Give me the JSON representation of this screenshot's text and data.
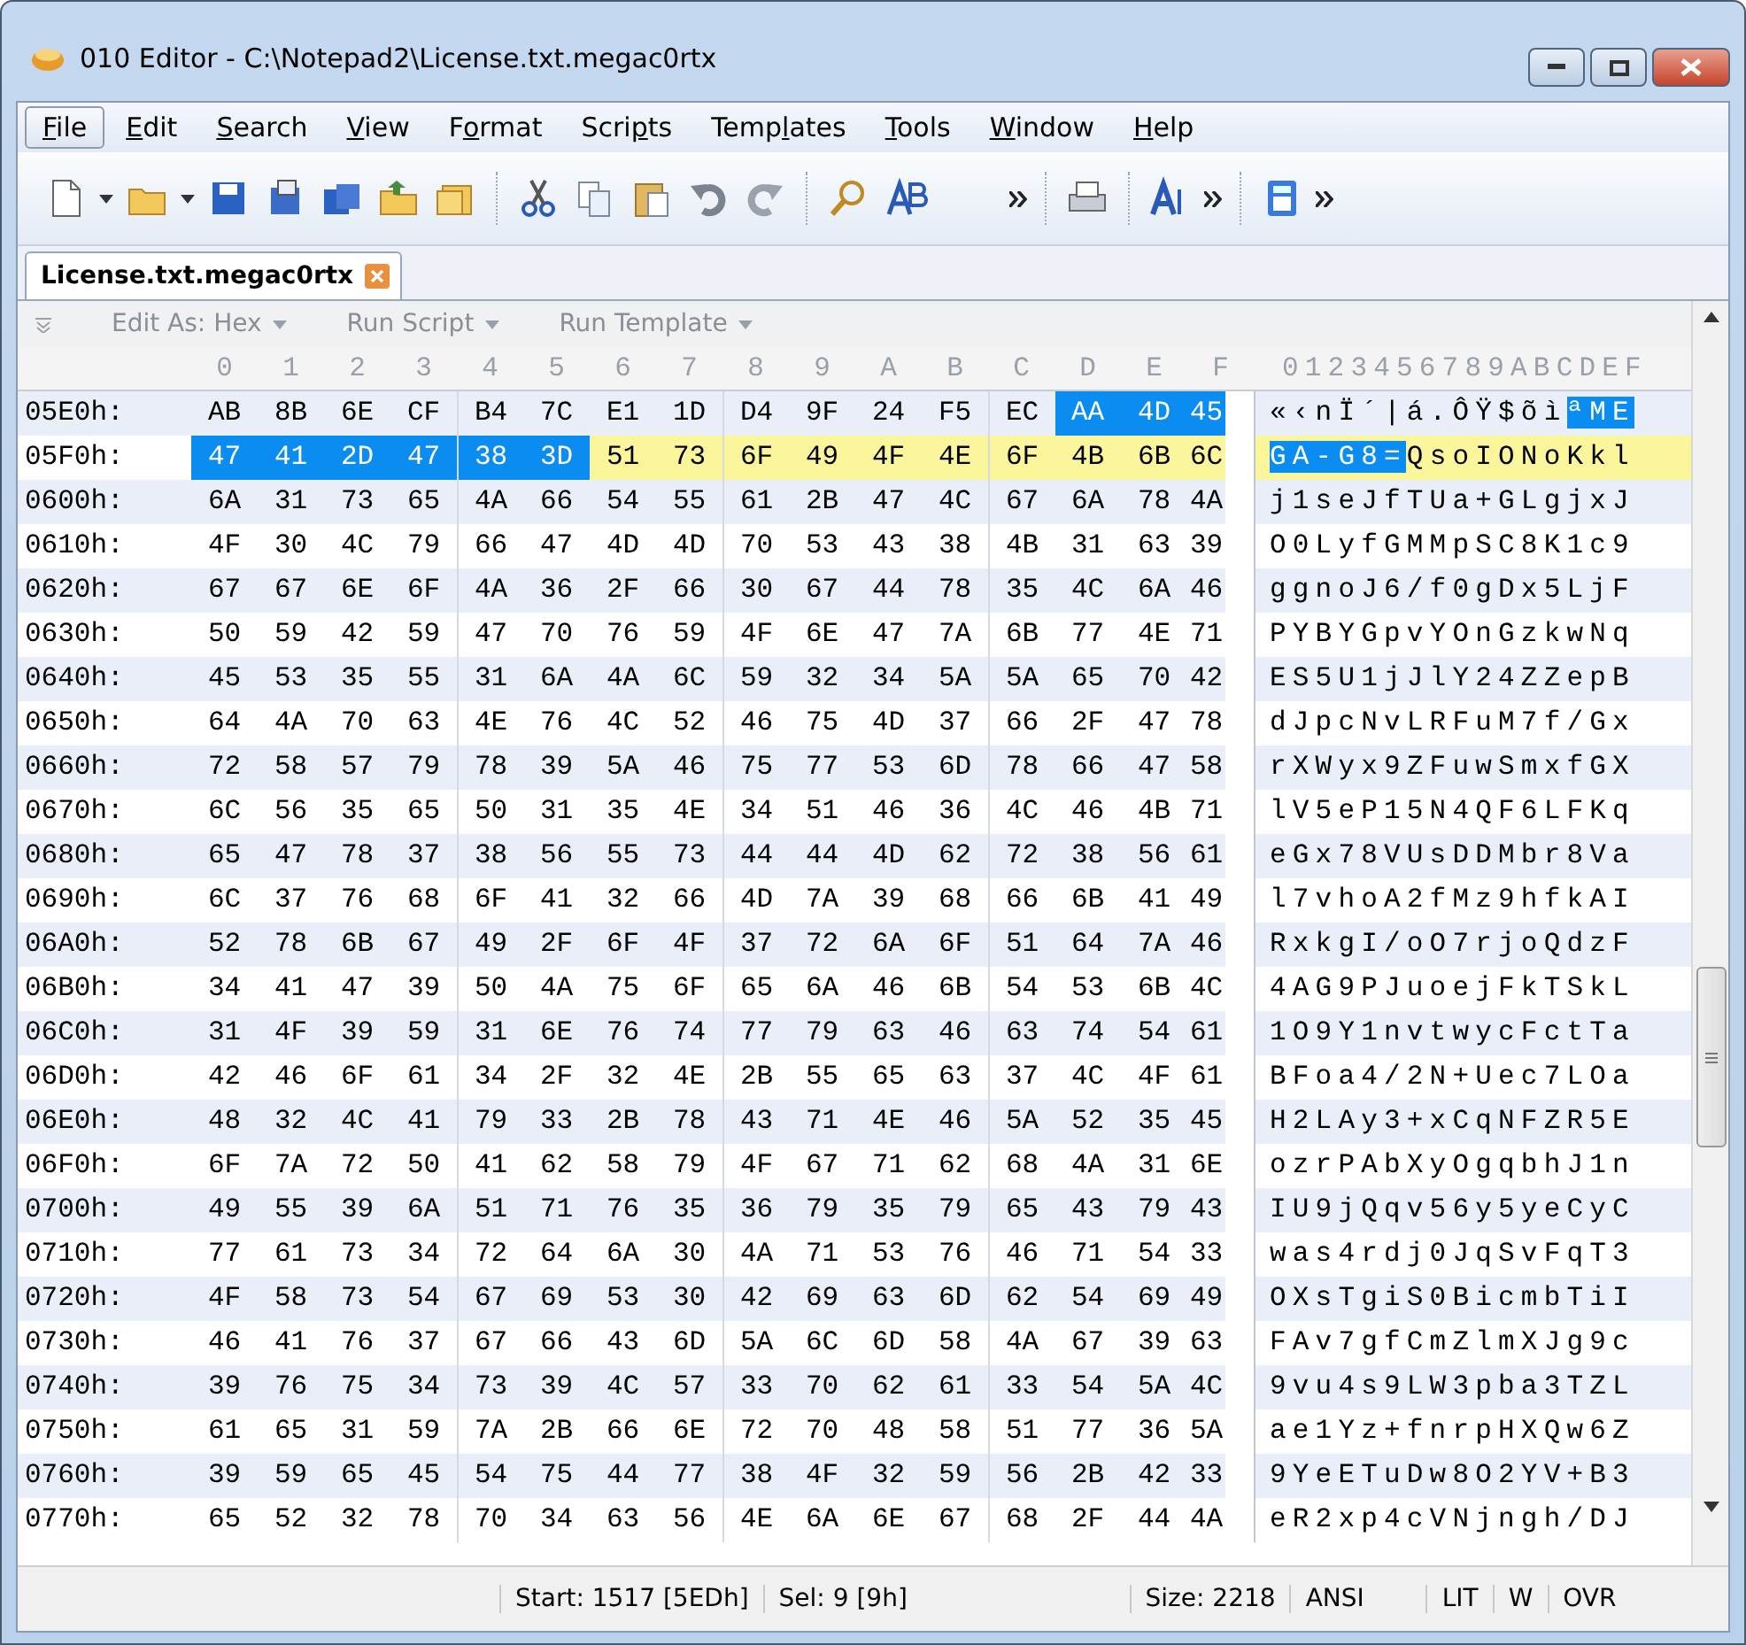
{
  "window": {
    "title": "010 Editor - C:\\Notepad2\\License.txt.megac0rtx"
  },
  "menu": [
    {
      "key": "F",
      "post": "ile",
      "selected": true
    },
    {
      "key": "E",
      "post": "dit",
      "selected": false
    },
    {
      "key": "S",
      "post": "earch",
      "selected": false
    },
    {
      "key": "V",
      "post": "iew",
      "selected": false
    },
    {
      "pre": "F",
      "key": "o",
      "post": "rmat",
      "selected": false
    },
    {
      "pre": "Scri",
      "key": "p",
      "post": "ts",
      "selected": false
    },
    {
      "pre": "Temp",
      "key": "l",
      "post": "ates",
      "selected": false
    },
    {
      "key": "T",
      "post": "ools",
      "selected": false
    },
    {
      "key": "W",
      "post": "indow",
      "selected": false
    },
    {
      "key": "H",
      "post": "elp",
      "selected": false
    }
  ],
  "tabs": [
    {
      "label": "License.txt.megac0rtx",
      "selected": true
    }
  ],
  "subtoolbar": [
    "Edit As: Hex",
    "Run Script",
    "Run Template"
  ],
  "hex_header": {
    "columns": [
      "0",
      "1",
      "2",
      "3",
      "4",
      "5",
      "6",
      "7",
      "8",
      "9",
      "A",
      "B",
      "C",
      "D",
      "E",
      "F"
    ],
    "ascii": "0123456789ABCDEF"
  },
  "rows": [
    {
      "address": "05E0h:",
      "current": false,
      "hex": [
        {
          "text": "AB 8B 6E CF B4 7C E1 1D D4 9F 24 F5 EC",
          "selected": false
        },
        {
          "text": "AA 4D 45",
          "selected": true
        }
      ],
      "ascii": [
        {
          "text": "«‹nÏ´|á.ÔŸ$õì",
          "selected": false
        },
        {
          "text": "ªME",
          "selected": true
        }
      ]
    },
    {
      "address": "05F0h:",
      "current": true,
      "hex": [
        {
          "text": "47 41 2D 47 38 3D",
          "selected": true
        },
        {
          "text": "51 73 6F 49 4F 4E 6F 4B 6B 6C",
          "selected": false
        }
      ],
      "ascii": [
        {
          "text": "GA-G8=",
          "selected": true
        },
        {
          "text": "QsoIONoKkl",
          "selected": false
        }
      ]
    },
    {
      "address": "0600h:",
      "current": false,
      "hex": [
        {
          "text": "6A 31 73 65 4A 66 54 55 61 2B 47 4C 67 6A 78 4A",
          "selected": false
        }
      ],
      "ascii": [
        {
          "text": "j1seJfTUa+GLgjxJ",
          "selected": false
        }
      ]
    },
    {
      "address": "0610h:",
      "current": false,
      "hex": [
        {
          "text": "4F 30 4C 79 66 47 4D 4D 70 53 43 38 4B 31 63 39",
          "selected": false
        }
      ],
      "ascii": [
        {
          "text": "O0LyfGMMpSC8K1c9",
          "selected": false
        }
      ]
    },
    {
      "address": "0620h:",
      "current": false,
      "hex": [
        {
          "text": "67 67 6E 6F 4A 36 2F 66 30 67 44 78 35 4C 6A 46",
          "selected": false
        }
      ],
      "ascii": [
        {
          "text": "ggnoJ6/f0gDx5LjF",
          "selected": false
        }
      ]
    },
    {
      "address": "0630h:",
      "current": false,
      "hex": [
        {
          "text": "50 59 42 59 47 70 76 59 4F 6E 47 7A 6B 77 4E 71",
          "selected": false
        }
      ],
      "ascii": [
        {
          "text": "PYBYGpvYOnGzkwNq",
          "selected": false
        }
      ]
    },
    {
      "address": "0640h:",
      "current": false,
      "hex": [
        {
          "text": "45 53 35 55 31 6A 4A 6C 59 32 34 5A 5A 65 70 42",
          "selected": false
        }
      ],
      "ascii": [
        {
          "text": "ES5U1jJlY24ZZepB",
          "selected": false
        }
      ]
    },
    {
      "address": "0650h:",
      "current": false,
      "hex": [
        {
          "text": "64 4A 70 63 4E 76 4C 52 46 75 4D 37 66 2F 47 78",
          "selected": false
        }
      ],
      "ascii": [
        {
          "text": "dJpcNvLRFuM7f/Gx",
          "selected": false
        }
      ]
    },
    {
      "address": "0660h:",
      "current": false,
      "hex": [
        {
          "text": "72 58 57 79 78 39 5A 46 75 77 53 6D 78 66 47 58",
          "selected": false
        }
      ],
      "ascii": [
        {
          "text": "rXWyx9ZFuwSmxfGX",
          "selected": false
        }
      ]
    },
    {
      "address": "0670h:",
      "current": false,
      "hex": [
        {
          "text": "6C 56 35 65 50 31 35 4E 34 51 46 36 4C 46 4B 71",
          "selected": false
        }
      ],
      "ascii": [
        {
          "text": "lV5eP15N4QF6LFKq",
          "selected": false
        }
      ]
    },
    {
      "address": "0680h:",
      "current": false,
      "hex": [
        {
          "text": "65 47 78 37 38 56 55 73 44 44 4D 62 72 38 56 61",
          "selected": false
        }
      ],
      "ascii": [
        {
          "text": "eGx78VUsDDMbr8Va",
          "selected": false
        }
      ]
    },
    {
      "address": "0690h:",
      "current": false,
      "hex": [
        {
          "text": "6C 37 76 68 6F 41 32 66 4D 7A 39 68 66 6B 41 49",
          "selected": false
        }
      ],
      "ascii": [
        {
          "text": "l7vhoA2fMz9hfkAI",
          "selected": false
        }
      ]
    },
    {
      "address": "06A0h:",
      "current": false,
      "hex": [
        {
          "text": "52 78 6B 67 49 2F 6F 4F 37 72 6A 6F 51 64 7A 46",
          "selected": false
        }
      ],
      "ascii": [
        {
          "text": "RxkgI/oO7rjoQdzF",
          "selected": false
        }
      ]
    },
    {
      "address": "06B0h:",
      "current": false,
      "hex": [
        {
          "text": "34 41 47 39 50 4A 75 6F 65 6A 46 6B 54 53 6B 4C",
          "selected": false
        }
      ],
      "ascii": [
        {
          "text": "4AG9PJuoejFkTSkL",
          "selected": false
        }
      ]
    },
    {
      "address": "06C0h:",
      "current": false,
      "hex": [
        {
          "text": "31 4F 39 59 31 6E 76 74 77 79 63 46 63 74 54 61",
          "selected": false
        }
      ],
      "ascii": [
        {
          "text": "1O9Y1nvtwycFctTa",
          "selected": false
        }
      ]
    },
    {
      "address": "06D0h:",
      "current": false,
      "hex": [
        {
          "text": "42 46 6F 61 34 2F 32 4E 2B 55 65 63 37 4C 4F 61",
          "selected": false
        }
      ],
      "ascii": [
        {
          "text": "BFoa4/2N+Uec7LOa",
          "selected": false
        }
      ]
    },
    {
      "address": "06E0h:",
      "current": false,
      "hex": [
        {
          "text": "48 32 4C 41 79 33 2B 78 43 71 4E 46 5A 52 35 45",
          "selected": false
        }
      ],
      "ascii": [
        {
          "text": "H2LAy3+xCqNFZR5E",
          "selected": false
        }
      ]
    },
    {
      "address": "06F0h:",
      "current": false,
      "hex": [
        {
          "text": "6F 7A 72 50 41 62 58 79 4F 67 71 62 68 4A 31 6E",
          "selected": false
        }
      ],
      "ascii": [
        {
          "text": "ozrPAbXyOgqbhJ1n",
          "selected": false
        }
      ]
    },
    {
      "address": "0700h:",
      "current": false,
      "hex": [
        {
          "text": "49 55 39 6A 51 71 76 35 36 79 35 79 65 43 79 43",
          "selected": false
        }
      ],
      "ascii": [
        {
          "text": "IU9jQqv56y5yeCyC",
          "selected": false
        }
      ]
    },
    {
      "address": "0710h:",
      "current": false,
      "hex": [
        {
          "text": "77 61 73 34 72 64 6A 30 4A 71 53 76 46 71 54 33",
          "selected": false
        }
      ],
      "ascii": [
        {
          "text": "was4rdj0JqSvFqT3",
          "selected": false
        }
      ]
    },
    {
      "address": "0720h:",
      "current": false,
      "hex": [
        {
          "text": "4F 58 73 54 67 69 53 30 42 69 63 6D 62 54 69 49",
          "selected": false
        }
      ],
      "ascii": [
        {
          "text": "OXsTgiS0BicmbTiI",
          "selected": false
        }
      ]
    },
    {
      "address": "0730h:",
      "current": false,
      "hex": [
        {
          "text": "46 41 76 37 67 66 43 6D 5A 6C 6D 58 4A 67 39 63",
          "selected": false
        }
      ],
      "ascii": [
        {
          "text": "FAv7gfCmZlmXJg9c",
          "selected": false
        }
      ]
    },
    {
      "address": "0740h:",
      "current": false,
      "hex": [
        {
          "text": "39 76 75 34 73 39 4C 57 33 70 62 61 33 54 5A 4C",
          "selected": false
        }
      ],
      "ascii": [
        {
          "text": "9vu4s9LW3pba3TZL",
          "selected": false
        }
      ]
    },
    {
      "address": "0750h:",
      "current": false,
      "hex": [
        {
          "text": "61 65 31 59 7A 2B 66 6E 72 70 48 58 51 77 36 5A",
          "selected": false
        }
      ],
      "ascii": [
        {
          "text": "ae1Yz+fnrpHXQw6Z",
          "selected": false
        }
      ]
    },
    {
      "address": "0760h:",
      "current": false,
      "hex": [
        {
          "text": "39 59 65 45 54 75 44 77 38 4F 32 59 56 2B 42 33",
          "selected": false
        }
      ],
      "ascii": [
        {
          "text": "9YeETuDw8O2YV+B3",
          "selected": false
        }
      ]
    },
    {
      "address": "0770h:",
      "current": false,
      "hex": [
        {
          "text": "65 52 32 78 70 34 63 56 4E 6A 6E 67 68 2F 44 4A",
          "selected": false
        }
      ],
      "ascii": [
        {
          "text": "eR2xp4cVNjngh/DJ",
          "selected": false
        }
      ]
    }
  ],
  "status_bar": {
    "start": "Start: 1517 [5EDh]",
    "selection": "Sel: 9 [9h]",
    "size": "Size: 2218",
    "encoding": "ANSI",
    "flags": [
      "LIT",
      "W",
      "OVR"
    ]
  }
}
